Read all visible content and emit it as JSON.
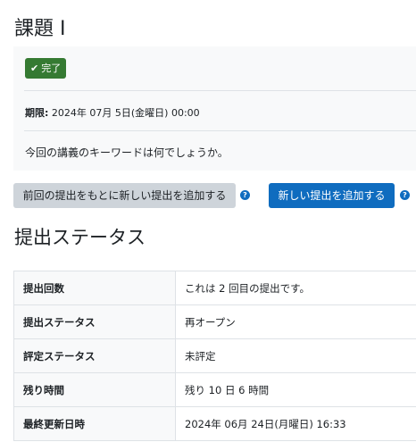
{
  "assignment": {
    "title": "課題 I",
    "completion_badge": "完了",
    "due_label": "期限:",
    "due_value": " 2024年 07月 5日(金曜日) 00:00",
    "description": "今回の講義のキーワードは何でしょうか。"
  },
  "actions": {
    "add_from_previous_label": "前回の提出をもとに新しい提出を追加する",
    "add_new_label": "新しい提出を追加する"
  },
  "submission_status": {
    "heading": "提出ステータス",
    "rows": [
      {
        "label": "提出回数",
        "value": "これは 2 回目の提出です。"
      },
      {
        "label": "提出ステータス",
        "value": "再オープン"
      },
      {
        "label": "評定ステータス",
        "value": "未評定"
      },
      {
        "label": "残り時間",
        "value": "残り 10 日 6 時間"
      },
      {
        "label": "最終更新日時",
        "value": "2024年 06月 24日(月曜日) 16:33"
      }
    ]
  },
  "colors": {
    "completion_badge": "#357a32",
    "primary_button": "#0f6cbf",
    "secondary_button": "#ced4da"
  },
  "icons": {
    "badge": "check-icon",
    "help": "question-circle-icon"
  }
}
